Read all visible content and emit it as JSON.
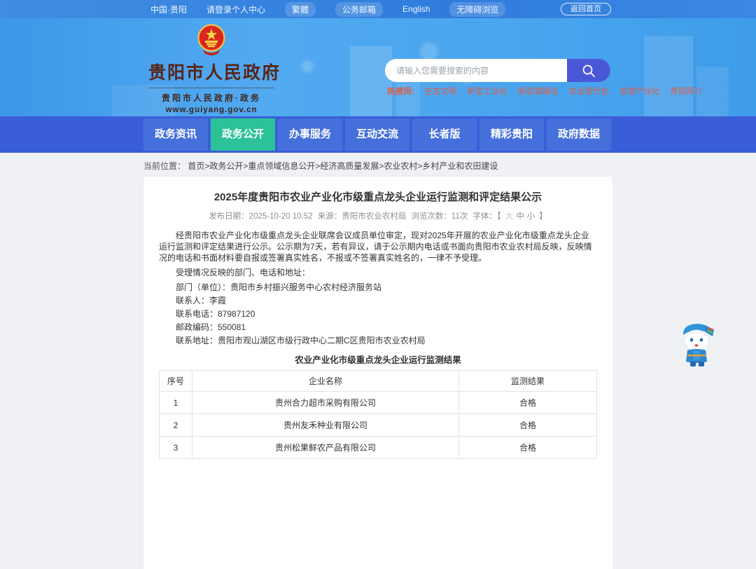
{
  "topbar": {
    "links": [
      {
        "label": "中国·贵阳",
        "pill": false
      },
      {
        "label": "请登录个人中心",
        "pill": false
      },
      {
        "label": "繁體",
        "pill": true
      },
      {
        "label": "公务邮箱",
        "pill": true
      },
      {
        "label": "English",
        "pill": false
      },
      {
        "label": "无障碍浏览",
        "pill": true
      }
    ],
    "home_button": "返回首页"
  },
  "header": {
    "site_title": "贵阳市人民政府",
    "site_subtitle": "贵阳市人民政府·政务",
    "site_url": "www.guiyang.gov.cn",
    "search": {
      "placeholder": "请输入您需要搜索的内容"
    },
    "hot_search": {
      "label": "热搜词:",
      "terms": [
        "生态文明",
        "新型工业化",
        "新型城镇化",
        "农业现代化",
        "旅游产业化",
        "贵阳简介"
      ]
    }
  },
  "nav": {
    "items": [
      {
        "label": "政务资讯",
        "active": false
      },
      {
        "label": "政务公开",
        "active": true
      },
      {
        "label": "办事服务",
        "active": false
      },
      {
        "label": "互动交流",
        "active": false
      },
      {
        "label": "长者版",
        "active": false
      },
      {
        "label": "精彩贵阳",
        "active": false
      },
      {
        "label": "政府数据",
        "active": false
      }
    ]
  },
  "breadcrumb": {
    "label": "当前位置：",
    "path": "首页>政务公开>重点领域信息公开>经济高质量发展>农业农村>乡村产业和农田建设"
  },
  "article": {
    "title": "2025年度贵阳市农业产业化市级重点龙头企业运行监测和评定结果公示",
    "meta": {
      "publish": "发布日期：2025-10-20 10:52",
      "source": "来源：贵阳市农业农村局",
      "views": "浏览次数：11次",
      "font_prefix": "字体：【",
      "font_sizes": [
        "大",
        "中",
        "小"
      ],
      "font_suffix": "】"
    },
    "paragraphs": [
      "经贵阳市农业产业化市级重点龙头企业联席会议成员单位审定，现对2025年开展的农业产业化市级重点龙头企业运行监测和评定结果进行公示。公示期为7天，若有异议，请于公示期内电话或书面向贵阳市农业农村局反映，反映情况的电话和书面材料要自报或签署真实姓名，不报或不签署真实姓名的，一律不予受理。",
      "受理情况反映的部门、电话和地址：",
      "部门（单位）：贵阳市乡村振兴服务中心农村经济服务站",
      "联系人：李霞",
      "联系电话：87987120",
      "邮政编码：550081",
      "联系地址：贵阳市观山湖区市级行政中心二期C区贵阳市农业农村局"
    ],
    "table": {
      "caption": "农业产业化市级重点龙头企业运行监测结果",
      "headers": [
        "序号",
        "企业名称",
        "监测结果"
      ],
      "rows": [
        [
          "1",
          "贵州合力超市采购有限公司",
          "合格"
        ],
        [
          "2",
          "贵州友禾种业有限公司",
          "合格"
        ],
        [
          "3",
          "贵州松果鲜农产品有限公司",
          "合格"
        ]
      ]
    }
  },
  "icons": {
    "search": "search-icon",
    "emblem": "national-emblem-icon",
    "mascot": "mascot-figure"
  },
  "colors": {
    "topbar_blue": "#3584e0",
    "banner_blue": "#49a5ee",
    "nav_band": "#3a5ed8",
    "nav_button": "#4570dc",
    "nav_active": "#2cc298",
    "search_button": "#4a58d8",
    "hot_word_red": "#e45a45",
    "logo_brown": "#5a2418"
  }
}
